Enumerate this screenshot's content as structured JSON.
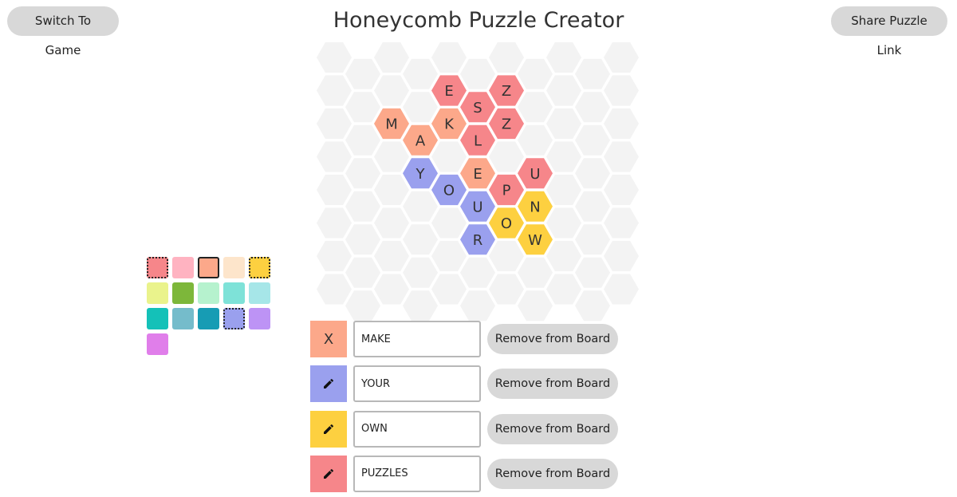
{
  "header": {
    "title": "Honeycomb Puzzle Creator",
    "switch_label": "Switch To Game",
    "share_label": "Share Puzzle Link"
  },
  "colors": {
    "empty_cell": "#f3f3f3",
    "red": "#f6868a",
    "orange": "#fca88a",
    "blue": "#9aa0ee",
    "yellow": "#fdd040"
  },
  "board": {
    "tiles": [
      {
        "letter": "S",
        "color": "red"
      },
      {
        "letter": "E",
        "color": "red"
      },
      {
        "letter": "Z",
        "color": "red"
      },
      {
        "letter": "A",
        "color": "orange"
      },
      {
        "letter": "L",
        "color": "red"
      },
      {
        "letter": "M",
        "color": "orange"
      },
      {
        "letter": "K",
        "color": "orange"
      },
      {
        "letter": "Z",
        "color": "red"
      },
      {
        "letter": "Y",
        "color": "blue"
      },
      {
        "letter": "E",
        "color": "orange"
      },
      {
        "letter": "U",
        "color": "red"
      },
      {
        "letter": "O",
        "color": "blue"
      },
      {
        "letter": "P",
        "color": "red"
      },
      {
        "letter": "U",
        "color": "blue"
      },
      {
        "letter": "N",
        "color": "yellow"
      },
      {
        "letter": "O",
        "color": "yellow"
      },
      {
        "letter": "R",
        "color": "blue"
      },
      {
        "letter": "W",
        "color": "yellow"
      }
    ]
  },
  "palette": {
    "swatches": [
      {
        "color": "#f6868a",
        "state": "dotted"
      },
      {
        "color": "#ffb3c1",
        "state": "none"
      },
      {
        "color": "#fca88a",
        "state": "solid"
      },
      {
        "color": "#fde5cb",
        "state": "none"
      },
      {
        "color": "#fdd040",
        "state": "dotted"
      },
      {
        "color": "#eaf38c",
        "state": "none"
      },
      {
        "color": "#7db73a",
        "state": "none"
      },
      {
        "color": "#b6f2ce",
        "state": "none"
      },
      {
        "color": "#7ee2d8",
        "state": "none"
      },
      {
        "color": "#a6e6e8",
        "state": "none"
      },
      {
        "color": "#14c1b8",
        "state": "none"
      },
      {
        "color": "#75bccb",
        "state": "none"
      },
      {
        "color": "#179cb4",
        "state": "none"
      },
      {
        "color": "#9aa0ee",
        "state": "dotted"
      },
      {
        "color": "#bd93f5",
        "state": "none"
      },
      {
        "color": "#e07eea",
        "state": "none"
      }
    ]
  },
  "words": [
    {
      "value": "MAKE",
      "color": "#fca88a",
      "icon": "close-icon",
      "glyph": "X",
      "remove_label": "Remove from Board"
    },
    {
      "value": "YOUR",
      "color": "#9aa0ee",
      "icon": "pencil-icon",
      "glyph": "",
      "remove_label": "Remove from Board"
    },
    {
      "value": "OWN",
      "color": "#fdd040",
      "icon": "pencil-icon",
      "glyph": "",
      "remove_label": "Remove from Board"
    },
    {
      "value": "PUZZLES",
      "color": "#f6868a",
      "icon": "pencil-icon",
      "glyph": "",
      "remove_label": "Remove from Board"
    }
  ]
}
